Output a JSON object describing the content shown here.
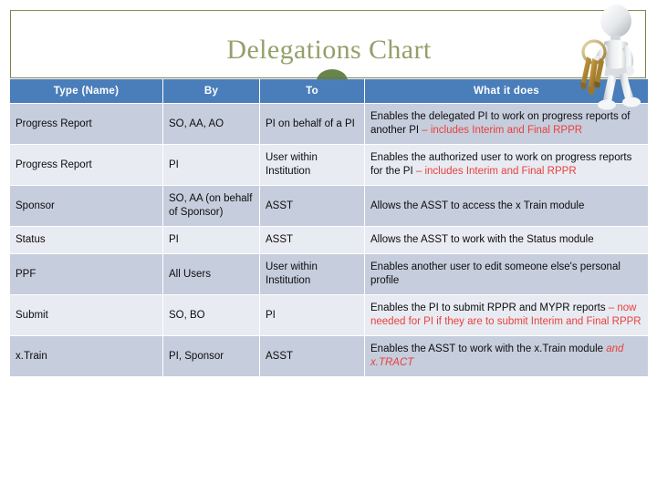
{
  "slide": {
    "title": "Delegations Chart",
    "title_color": "#94a06a",
    "frame_border_color": "#7f7f52",
    "header_bg": "#4a7ebb",
    "row_dark_bg": "#c6cddd",
    "row_light_bg": "#e8ebf2",
    "accent_red": "#e8413c",
    "mound_color": "#5c7a3c"
  },
  "decor": {
    "key_figure_icon": "person-holding-keys-icon",
    "green_mound_icon": "green-mound-icon"
  },
  "table": {
    "columns": [
      "Type (Name)",
      "By",
      "To",
      "What it does"
    ],
    "rows": [
      {
        "type": "Progress Report",
        "by": "SO, AA, AO",
        "to": "PI on behalf of a PI",
        "what_black": "Enables the delegated PI to work on progress reports of another PI ",
        "what_red": "– includes Interim and Final RPPR",
        "what_red_italic": ""
      },
      {
        "type": "Progress Report",
        "by": "PI",
        "to": "User within Institution",
        "what_black": "Enables the authorized user to work on progress reports for the PI ",
        "what_red": "– includes Interim and Final RPPR",
        "what_red_italic": ""
      },
      {
        "type": "Sponsor",
        "by": "SO, AA (on behalf of Sponsor)",
        "to": "ASST",
        "what_black": "Allows the ASST to access the x Train module",
        "what_red": "",
        "what_red_italic": ""
      },
      {
        "type": "Status",
        "by": "PI",
        "to": "ASST",
        "what_black": "Allows the ASST to work with the Status module",
        "what_red": "",
        "what_red_italic": ""
      },
      {
        "type": "PPF",
        "by": "All Users",
        "to": "User within Institution",
        "what_black": "Enables another user to edit someone else's personal profile",
        "what_red": "",
        "what_red_italic": ""
      },
      {
        "type": "Submit",
        "by": "SO, BO",
        "to": "PI",
        "what_black": "Enables the PI to submit RPPR and MYPR reports ",
        "what_red": "– now needed for PI if they are to submit Interim and Final RPPR",
        "what_red_italic": ""
      },
      {
        "type": "x.Train",
        "by": "PI, Sponsor",
        "to": "ASST",
        "what_black": "Enables the ASST to work with the x.Train module ",
        "what_red": "",
        "what_red_italic": "and x.TRACT"
      }
    ]
  }
}
